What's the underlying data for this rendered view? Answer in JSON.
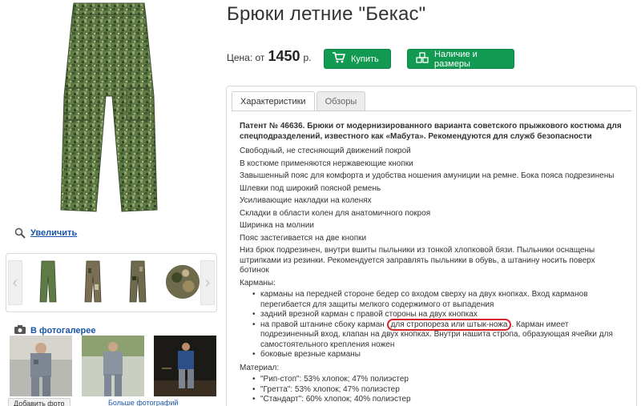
{
  "product": {
    "title": "Брюки летние \"Бекас\"",
    "price_label": "Цена: от",
    "price_value": "1450",
    "currency": "р."
  },
  "buttons": {
    "buy": "Купить",
    "stock": "Наличие и размеры"
  },
  "left": {
    "zoom_label": "Увеличить",
    "gallery_title": "В фотогалерее",
    "add_photo": "Добавить фото",
    "more_photos": "Больше фотографий"
  },
  "tabs": [
    "Характеристики",
    "Обзоры"
  ],
  "description": {
    "intro": "Патент № 46636. Брюки от модернизированного варианта советского прыжкового костюма для спецподразделений, известного как «Мабута». Рекомендуются для служб безопасности",
    "features": [
      "Свободный, не стесняющий движений покрой",
      "В костюме применяются нержавеющие кнопки",
      "Завышенный пояс для комфорта и удобства ношения амуниции на ремне. Бока пояса подрезинены",
      "Шлевки под широкий поясной ремень",
      "Усиливающие накладки на коленях",
      "Складки в области колен для анатомичного покроя",
      "Ширинка на молнии",
      "Пояс застегивается на две кнопки",
      "Низ брюк подрезинен, внутри вшиты пыльники из тонкой хлопковой бязи. Пыльники оснащены штрипками из резинки. Рекомендуется заправлять пыльники в обувь, а штанину носить поверх ботинок"
    ],
    "pockets_title": "Карманы:",
    "pockets": [
      "карманы на передней стороне бедер со входом сверху на двух кнопках. Вход карманов перегибается для защиты мелкого содержимого от выпадения",
      "задний врезной карман с правой стороны на двух кнопках"
    ],
    "pocket3_before": "на правой штанине сбоку карман ",
    "pocket3_highlight": "для стропореза или штык-ножа",
    "pocket3_after": ". Карман имеет подрезиненный вход, клапан на двух кнопках. Внутри нашита стропа, образующая ячейки для самостоятельного крепления ножен",
    "pocket4": "боковые врезные карманы",
    "material_title": "Материал:",
    "materials": [
      "\"Рип-стоп\": 53% хлопок; 47% полиэстер",
      "\"Гретта\": 53% хлопок; 47% полиэстер",
      "\"Стандарт\": 60% хлопок; 40% полиэстер"
    ]
  },
  "colors": {
    "accent_green": "#129a52",
    "link_blue": "#1a55a8",
    "highlight_red": "#d6262c"
  }
}
